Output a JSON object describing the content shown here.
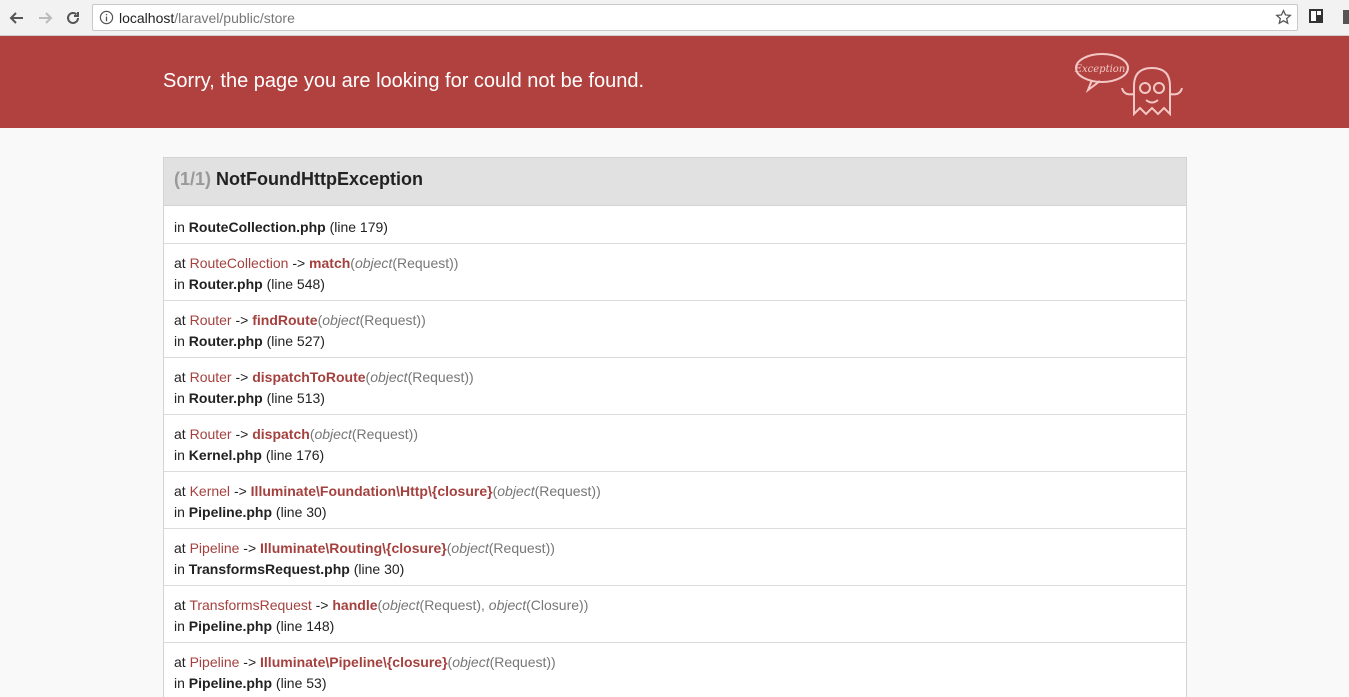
{
  "browser": {
    "url_host": "localhost",
    "url_path": "/laravel/public/store"
  },
  "header": {
    "title": "Sorry, the page you are looking for could not be found.",
    "mascot_text": "Exception!",
    "band_color": "#b0413e"
  },
  "exception": {
    "counter": "(1/1)",
    "name": "NotFoundHttpException",
    "origin": {
      "prefix": "in",
      "file": "RouteCollection.php",
      "line": "(line 179)"
    },
    "frames": [
      {
        "at": "at",
        "cls": "RouteCollection",
        "arrow": "->",
        "fn": "match",
        "open": "(",
        "args": [
          {
            "kw": "object",
            "val": "(Request)"
          }
        ],
        "close": ")",
        "in": "in",
        "file": "Router.php",
        "line": "(line 548)"
      },
      {
        "at": "at",
        "cls": "Router",
        "arrow": "->",
        "fn": "findRoute",
        "open": "(",
        "args": [
          {
            "kw": "object",
            "val": "(Request)"
          }
        ],
        "close": ")",
        "in": "in",
        "file": "Router.php",
        "line": "(line 527)"
      },
      {
        "at": "at",
        "cls": "Router",
        "arrow": "->",
        "fn": "dispatchToRoute",
        "open": "(",
        "args": [
          {
            "kw": "object",
            "val": "(Request)"
          }
        ],
        "close": ")",
        "in": "in",
        "file": "Router.php",
        "line": "(line 513)"
      },
      {
        "at": "at",
        "cls": "Router",
        "arrow": "->",
        "fn": "dispatch",
        "open": "(",
        "args": [
          {
            "kw": "object",
            "val": "(Request)"
          }
        ],
        "close": ")",
        "in": "in",
        "file": "Kernel.php",
        "line": "(line 176)"
      },
      {
        "at": "at",
        "cls": "Kernel",
        "arrow": "->",
        "fn": "Illuminate\\Foundation\\Http\\{closure}",
        "open": "(",
        "args": [
          {
            "kw": "object",
            "val": "(Request)"
          }
        ],
        "close": ")",
        "in": "in",
        "file": "Pipeline.php",
        "line": "(line 30)"
      },
      {
        "at": "at",
        "cls": "Pipeline",
        "arrow": "->",
        "fn": "Illuminate\\Routing\\{closure}",
        "open": "(",
        "args": [
          {
            "kw": "object",
            "val": "(Request)"
          }
        ],
        "close": ")",
        "in": "in",
        "file": "TransformsRequest.php",
        "line": "(line 30)"
      },
      {
        "at": "at",
        "cls": "TransformsRequest",
        "arrow": "->",
        "fn": "handle",
        "open": "(",
        "args": [
          {
            "kw": "object",
            "val": "(Request),"
          },
          {
            "kw": "object",
            "val": "(Closure)"
          }
        ],
        "close": ")",
        "in": "in",
        "file": "Pipeline.php",
        "line": "(line 148)"
      },
      {
        "at": "at",
        "cls": "Pipeline",
        "arrow": "->",
        "fn": "Illuminate\\Pipeline\\{closure}",
        "open": "(",
        "args": [
          {
            "kw": "object",
            "val": "(Request)"
          }
        ],
        "close": ")",
        "in": "in",
        "file": "Pipeline.php",
        "line": "(line 53)"
      }
    ]
  },
  "icons": {
    "back": "back-arrow-icon",
    "forward": "forward-arrow-icon",
    "reload": "reload-icon",
    "info": "info-icon",
    "star": "star-icon",
    "extension": "extension-icon",
    "mascot": "ghost-mascot-icon"
  }
}
